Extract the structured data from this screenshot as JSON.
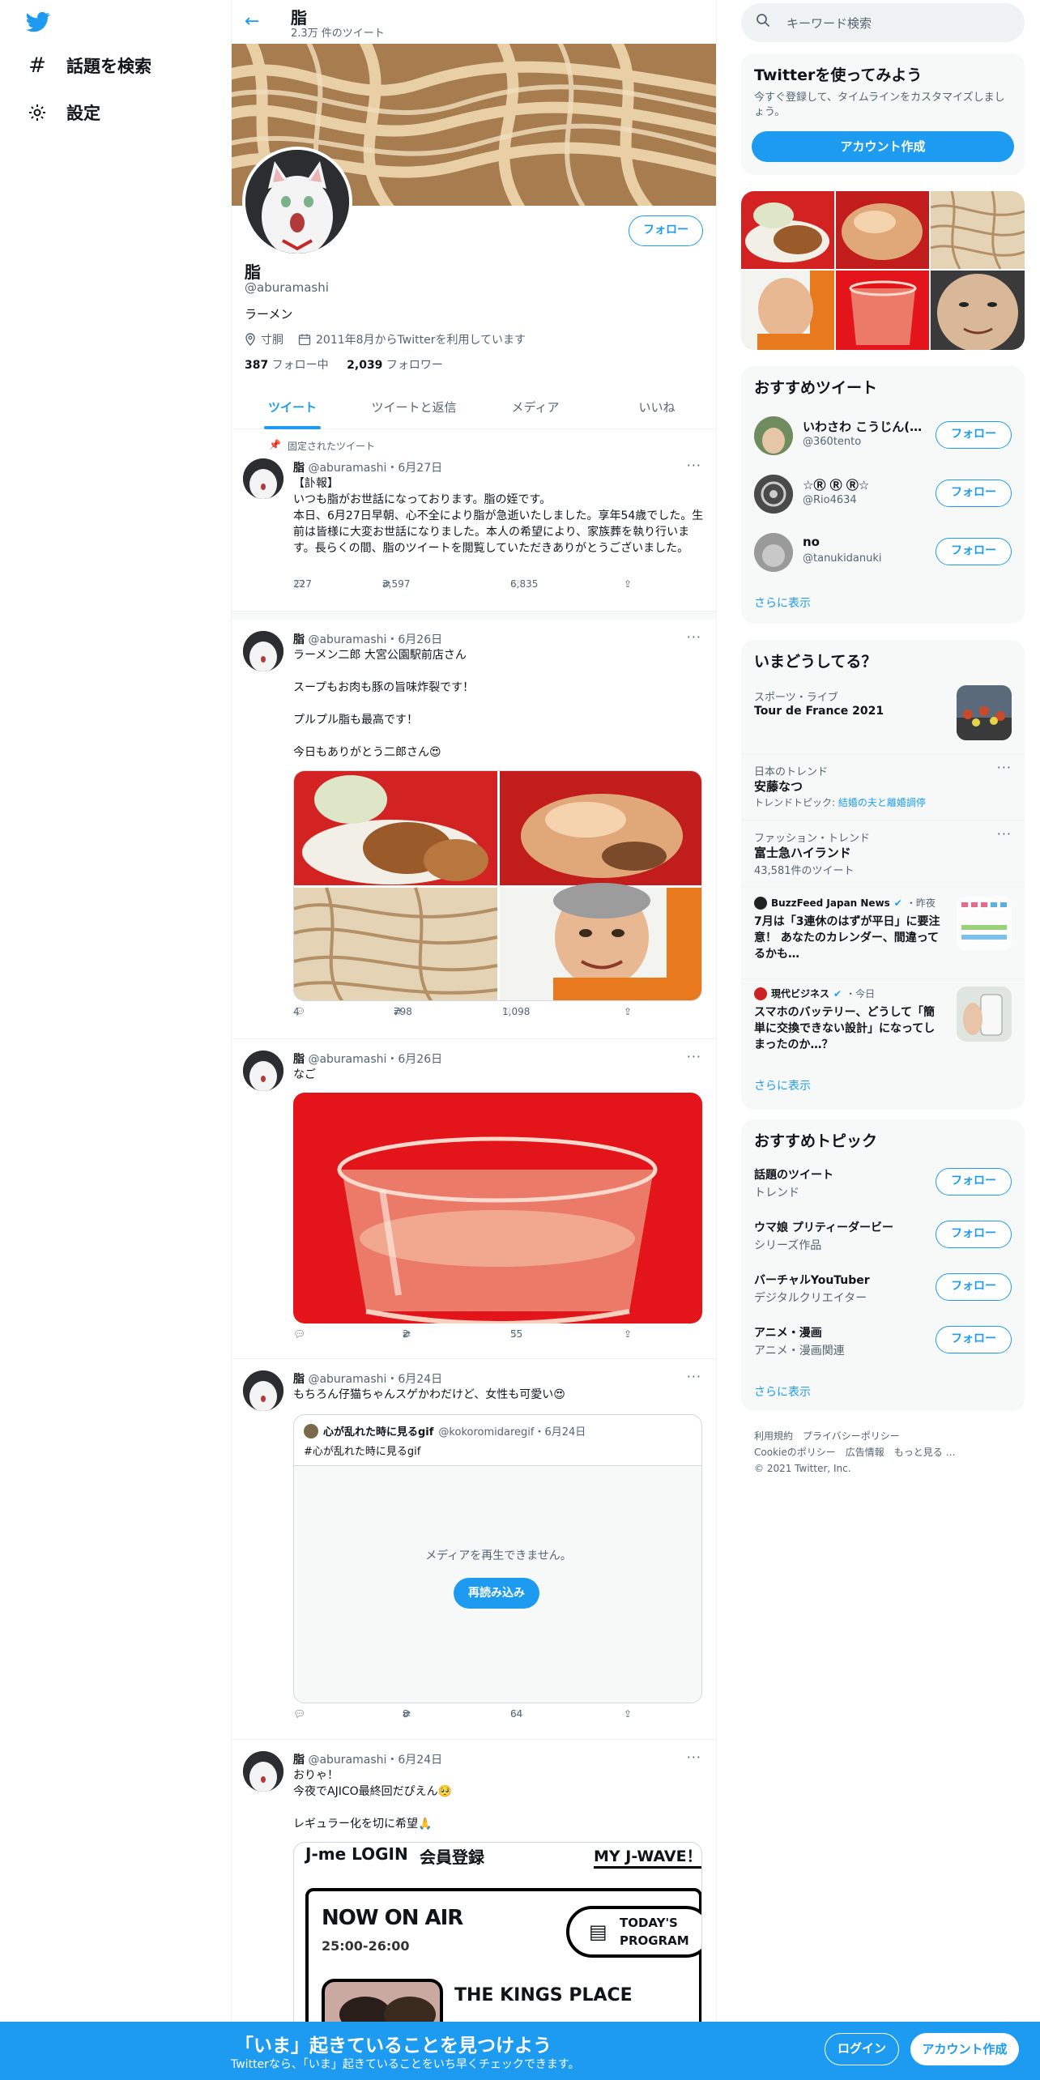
{
  "left_nav": {
    "explore_label": "話題を検索",
    "settings_label": "設定"
  },
  "header": {
    "title": "脂",
    "tweet_count": "2.3万 件のツイート"
  },
  "profile": {
    "name": "脂",
    "handle": "@aburamashi",
    "bio": "ラーメン",
    "location": "寸胴",
    "joined": "2011年8月からTwitterを利用しています",
    "following_count": "387",
    "following_label": " フォロー中",
    "followers_count": "2,039",
    "followers_label": " フォロワー",
    "follow_label": "フォロー"
  },
  "tabs": [
    "ツイート",
    "ツイートと返信",
    "メディア",
    "いいね"
  ],
  "tweets": [
    {
      "pinned_label": "固定されたツイート",
      "name": "脂",
      "meta": "@aburamashi・6月27日",
      "text": "【訃報】\nいつも脂がお世話になっております。脂の姪です。\n本日、6月27日早朝、心不全により脂が急逝いたしました。享年54歳でした。生前は皆様に大変お世話になりました。本人の希望により、家族葬を執り行います。長らくの間、脂のツイートを閲覧していただきありがとうございました。",
      "replies": "227",
      "retweets": "3,597",
      "likes": "6,835"
    },
    {
      "name": "脂",
      "meta": "@aburamashi・6月26日",
      "text": "ラーメン二郎 大宮公園駅前店さん\n\nスープもお肉も豚の旨味炸裂です！\n\nプルプル脂も最高です！\n\n今日もありがとう二郎さん😍",
      "replies": "4",
      "retweets": "798",
      "likes": "1,098"
    },
    {
      "name": "脂",
      "meta": "@aburamashi・6月26日",
      "text": "なご",
      "replies": "",
      "retweets": "2",
      "likes": "55"
    },
    {
      "name": "脂",
      "meta": "@aburamashi・6月24日",
      "text": "もちろん仔猫ちゃんスゲかわだけど、女性も可愛い😍",
      "quote_name": "心が乱れた時に見るgif",
      "quote_meta": "@kokoromidaregif・6月24日",
      "quote_text": "#心が乱れた時に見るgif",
      "media_error": "メディアを再生できません。",
      "reload_label": "再読み込み",
      "replies": "",
      "retweets": "8",
      "likes": "64"
    },
    {
      "name": "脂",
      "meta": "@aburamashi・6月24日",
      "text": "おりゃ！\n今夜でAJICO最終回だぴえん🥺\n\nレギュラー化を切に希望🙏",
      "card": {
        "login": "J-me LOGIN",
        "register": "会員登録",
        "myjwave": "MY J-WAVE！",
        "on_air": "NOW ON AIR",
        "time": "25:00-26:00",
        "program_line1": "TODAY'S",
        "program_line2": "PROGRAM",
        "show": "THE KINGS PLACE"
      }
    }
  ],
  "sidebar": {
    "search_placeholder": "キーワード検索",
    "signup": {
      "title": "Twitterを使ってみよう",
      "desc": "今すぐ登録して、タイムラインをカスタマイズしましょう。",
      "button": "アカウント作成"
    },
    "who_to_follow": {
      "title": "おすすめツイート",
      "users": [
        {
          "name": "いわさわ こうじん(…",
          "handle": "@360tento"
        },
        {
          "name": "☆Ⓡ Ⓡ Ⓡ☆",
          "handle": "@Rio4634"
        },
        {
          "name": "no",
          "handle": "@tanukidanuki"
        }
      ],
      "follow": "フォロー",
      "more": "さらに表示"
    },
    "trends": {
      "title": "いまどうしてる？",
      "items": [
        {
          "category": "スポーツ・ライブ",
          "title": "Tour de France 2021",
          "sub": ""
        },
        {
          "category": "日本のトレンド",
          "title": "安藤なつ",
          "sub": "トレンドトピック: ",
          "sub_link": "結婚の夫と離婚調停"
        },
        {
          "category": "ファッション・トレンド",
          "title": "富士急ハイランド",
          "sub": "43,581件のツイート"
        }
      ],
      "news": [
        {
          "source": "BuzzFeed Japan News",
          "time": "・昨夜",
          "title": "7月は「3連休のはずが平日」に要注意！ あなたのカレンダー、間違ってるかも…"
        },
        {
          "source": "現代ビジネス",
          "time": "・今日",
          "title": "スマホのバッテリー、どうして「簡単に交換できない設計」になってしまったのか…？"
        }
      ],
      "more": "さらに表示"
    },
    "topics": {
      "title": "おすすめトピック",
      "items": [
        {
          "title": "話題のツイート",
          "sub": "トレンド"
        },
        {
          "title": "ウマ娘 プリティーダービー",
          "sub": "シリーズ作品"
        },
        {
          "title": "バーチャルYouTuber",
          "sub": "デジタルクリエイター"
        },
        {
          "title": "アニメ・漫画",
          "sub": "アニメ・漫画関連"
        }
      ],
      "follow": "フォロー",
      "more": "さらに表示"
    },
    "footer": {
      "terms": "利用規約",
      "privacy": "プライバシーポリシー",
      "cookie": "Cookieのポリシー",
      "ads": "広告情報",
      "more": "もっと見る …",
      "copyright": "© 2021 Twitter, Inc."
    }
  },
  "bottom_bar": {
    "title": "「いま」起きていることを見つけよう",
    "sub": "Twitterなら、「いま」起きていることをいち早くチェックできます。",
    "login": "ログイン",
    "signup": "アカウント作成"
  }
}
